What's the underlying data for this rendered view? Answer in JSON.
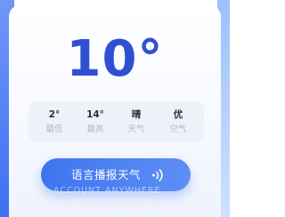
{
  "weather": {
    "temperature": "10°"
  },
  "stats": [
    {
      "value": "2°",
      "label": "最低"
    },
    {
      "value": "14°",
      "label": "最高"
    },
    {
      "value": "晴",
      "label": "天气"
    },
    {
      "value": "优",
      "label": "空气"
    }
  ],
  "actions": {
    "speak_label": "语言播报天气",
    "speak_icon": "sound-wave-icon"
  },
  "watermark": "ACCOUNT ANYWHERE",
  "colors": {
    "accent": "#2f50d2",
    "button_start": "#3f74f0",
    "button_end": "#5d8ff5",
    "info_bg": "#eef1f8"
  }
}
